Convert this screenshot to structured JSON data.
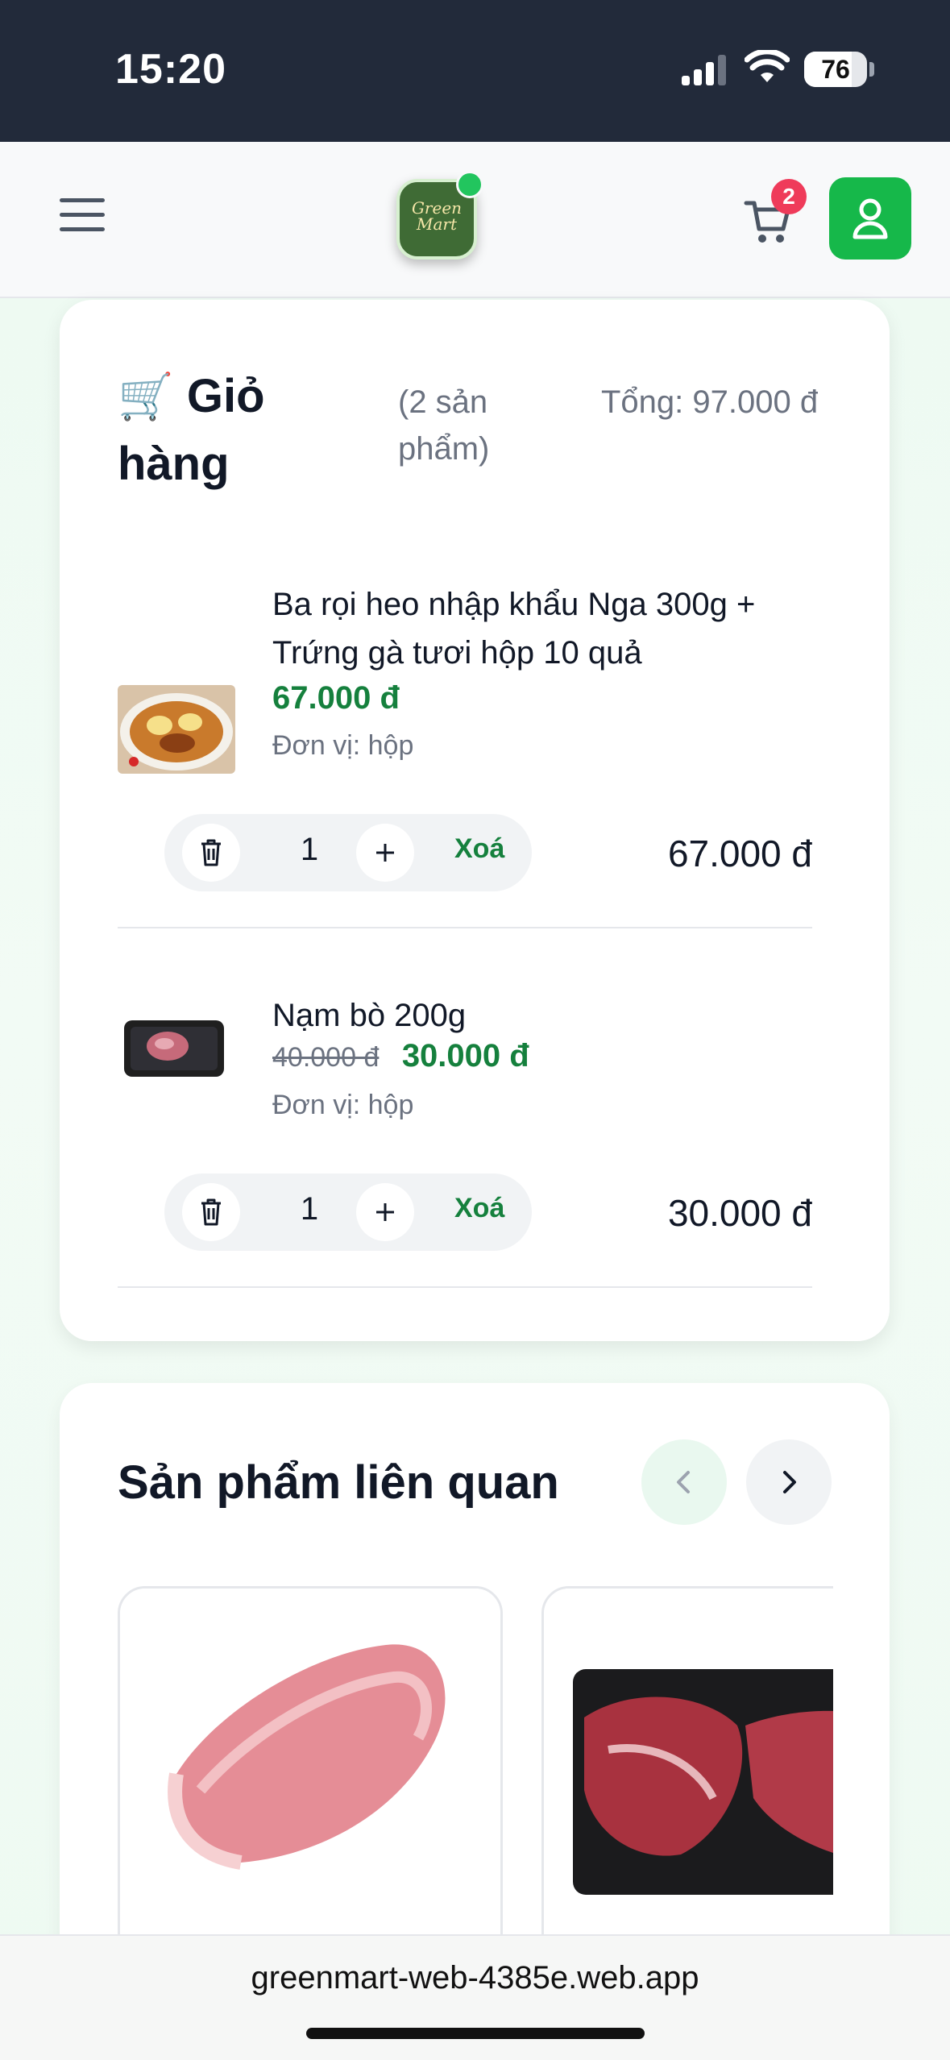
{
  "status_bar": {
    "time": "15:20",
    "battery": "76",
    "battery_level": 0.76
  },
  "header": {
    "cart_badge": "2",
    "logo_text_1": "Green",
    "logo_text_2": "Mart"
  },
  "cart": {
    "icon": "🛒",
    "title": "Giỏ hàng",
    "count": "(2 sản phẩm)",
    "total": "Tổng: 97.000 đ",
    "items": [
      {
        "name": "Ba rọi heo nhập khẩu Nga 300g + Trứng gà tươi hộp 10 quả",
        "price": "67.000 đ",
        "old_price": "",
        "unit": "Đơn vị: hộp",
        "quantity": "1",
        "remove_label": "Xoá",
        "line_total": "67.000 đ"
      },
      {
        "name": "Nạm bò 200g",
        "price": "30.000 đ",
        "old_price": "40.000 đ",
        "unit": "Đơn vị: hộp",
        "quantity": "1",
        "remove_label": "Xoá",
        "line_total": "30.000 đ"
      }
    ]
  },
  "related": {
    "title": "Sản phẩm liên quan"
  },
  "browser": {
    "url": "greenmart-web-4385e.web.app"
  },
  "colors": {
    "accent_green": "#15803d",
    "brand_green": "#16b84a",
    "badge_red": "#ef3b5a",
    "status_bar_bg": "#222a3a"
  },
  "icons": [
    "menu-icon",
    "cart-icon",
    "user-icon",
    "trash-icon",
    "plus-icon",
    "chevron-left-icon",
    "chevron-right-icon"
  ]
}
